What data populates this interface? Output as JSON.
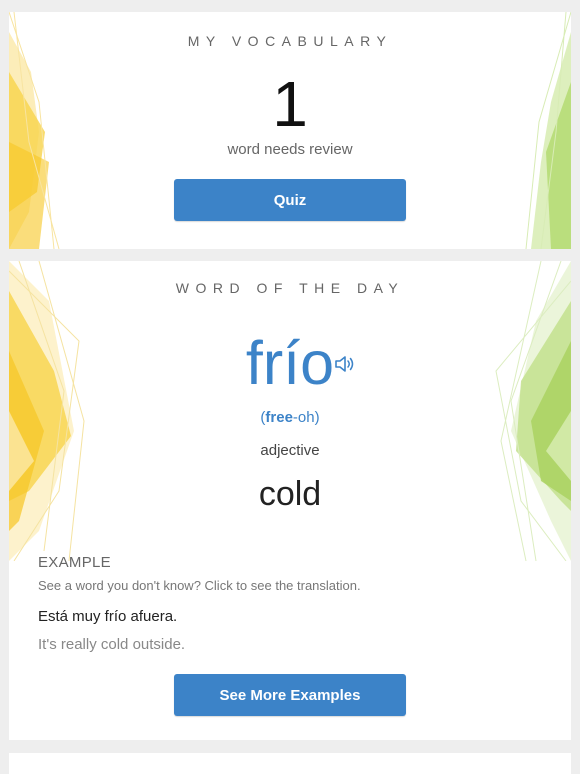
{
  "vocabulary": {
    "heading": "MY VOCABULARY",
    "count": "1",
    "count_label": "word needs review",
    "quiz_button": "Quiz"
  },
  "word_of_the_day": {
    "heading": "WORD OF THE DAY",
    "word": "frío",
    "pronunciation_open": "(",
    "pronunciation_stressed": "free",
    "pronunciation_rest": "-oh)",
    "part_of_speech": "adjective",
    "translation": "cold",
    "example_heading": "EXAMPLE",
    "example_hint": "See a word you don't know? Click to see the translation.",
    "example_spanish": "Está muy frío afuera.",
    "example_english": "It's really cold outside.",
    "more_button": "See More Examples"
  },
  "icons": {
    "speaker": "speaker-icon"
  },
  "colors": {
    "accent": "#3c83c8",
    "page_background": "#eeeeee",
    "deco_yellow": "#f8d34a",
    "deco_green": "#b2d96d"
  }
}
